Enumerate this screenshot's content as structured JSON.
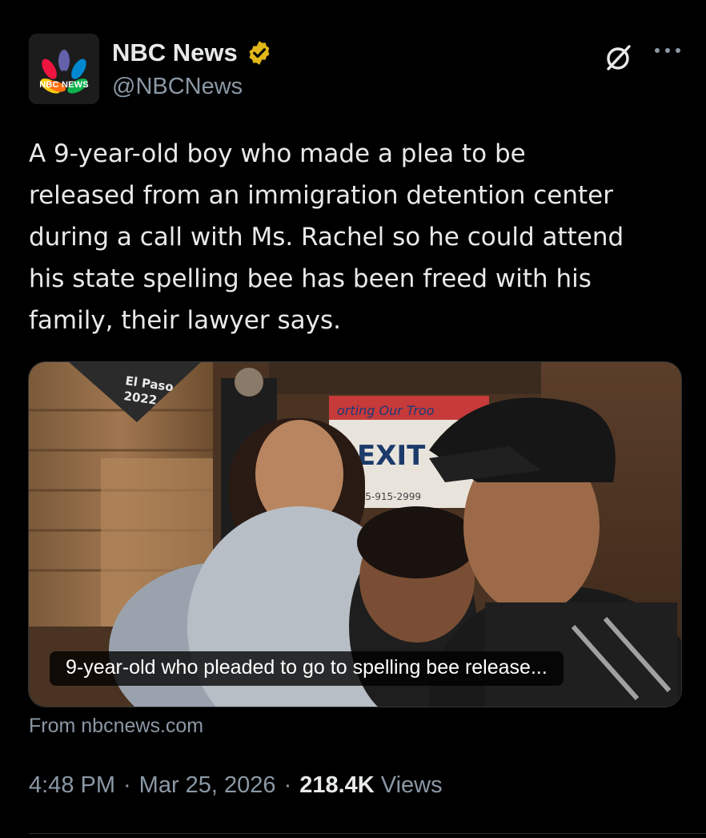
{
  "author": {
    "display_name": "NBC News",
    "handle": "@NBCNews",
    "avatar_text": "NBC NEWS",
    "verified_badge": "gold-check-icon",
    "verified_color": "#e2b719"
  },
  "actions": {
    "grok_icon": "grok-icon",
    "more_icon": "more-icon"
  },
  "tweet": {
    "text": "A 9-year-old boy who made a plea to be\nreleased from an immigration detention center\nduring a call with Ms. Rachel so he could attend\nhis state spelling bee has been freed with his\nfamily, their lawyer says."
  },
  "link_card": {
    "image_sign_text": "El Paso\n2022",
    "banner_text": "orting Our Troo",
    "sign_exit": "EXIT",
    "sign_phone": "575-915-2999",
    "caption": "9-year-old who pleaded to go to spelling bee release...",
    "source": "From nbcnews.com"
  },
  "meta": {
    "time": "4:48 PM",
    "date": "Mar 25, 2026",
    "views_count": "218.4K",
    "views_label": "Views",
    "separator": "·"
  },
  "colors": {
    "background": "#000000",
    "text_primary": "#e7e9ea",
    "text_secondary": "#8b98a5",
    "border": "#2f3336"
  }
}
